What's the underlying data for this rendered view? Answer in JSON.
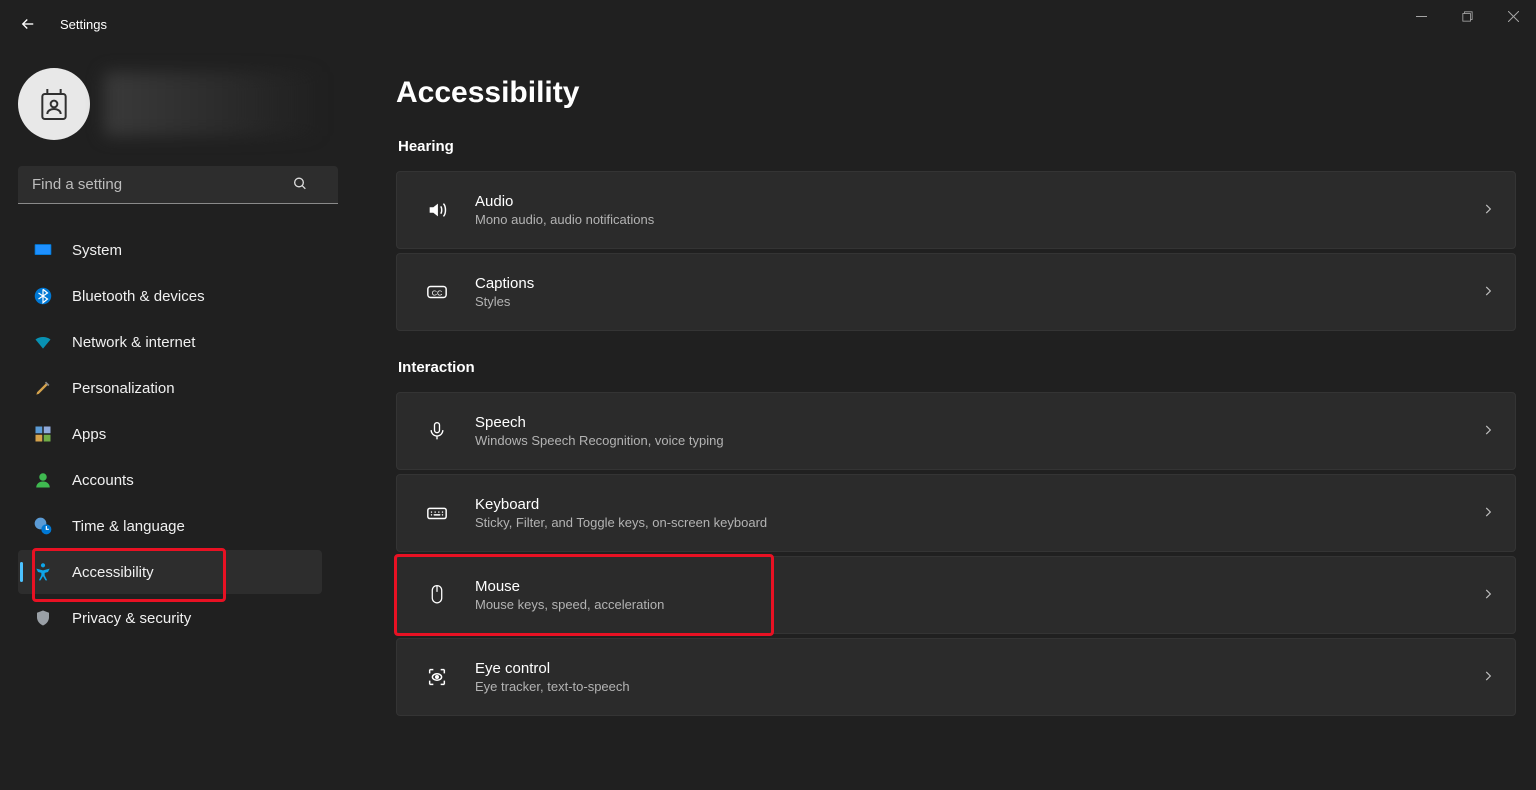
{
  "app_title": "Settings",
  "search": {
    "placeholder": "Find a setting"
  },
  "nav": {
    "system": "System",
    "bluetooth": "Bluetooth & devices",
    "network": "Network & internet",
    "personalization": "Personalization",
    "apps": "Apps",
    "accounts": "Accounts",
    "time": "Time & language",
    "accessibility": "Accessibility",
    "privacy": "Privacy & security"
  },
  "page": {
    "title": "Accessibility",
    "sections": {
      "hearing": "Hearing",
      "interaction": "Interaction"
    },
    "cards": {
      "audio": {
        "title": "Audio",
        "sub": "Mono audio, audio notifications"
      },
      "captions": {
        "title": "Captions",
        "sub": "Styles"
      },
      "speech": {
        "title": "Speech",
        "sub": "Windows Speech Recognition, voice typing"
      },
      "keyboard": {
        "title": "Keyboard",
        "sub": "Sticky, Filter, and Toggle keys, on-screen keyboard"
      },
      "mouse": {
        "title": "Mouse",
        "sub": "Mouse keys, speed, acceleration"
      },
      "eye": {
        "title": "Eye control",
        "sub": "Eye tracker, text-to-speech"
      }
    }
  }
}
